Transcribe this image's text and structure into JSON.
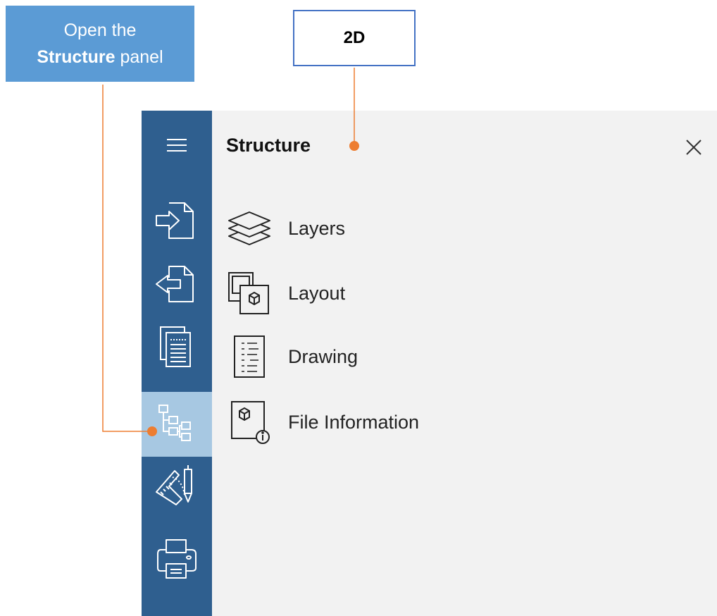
{
  "callouts": {
    "open_line1": "Open the",
    "open_bold": "Structure",
    "open_rest": "panel",
    "mode_label": "2D"
  },
  "sidebar": {
    "items": [
      {
        "icon": "hamburger-menu-icon",
        "active": false
      },
      {
        "icon": "import-icon",
        "active": false
      },
      {
        "icon": "export-icon",
        "active": false
      },
      {
        "icon": "documents-icon",
        "active": false
      },
      {
        "icon": "structure-tree-icon",
        "active": true
      },
      {
        "icon": "drafting-tools-icon",
        "active": false
      },
      {
        "icon": "printer-icon",
        "active": false
      }
    ]
  },
  "panel": {
    "title": "Structure",
    "close_icon": "close-icon",
    "items": [
      {
        "label": "Layers",
        "icon": "layers-icon"
      },
      {
        "label": "Layout",
        "icon": "layout-icon"
      },
      {
        "label": "Drawing",
        "icon": "drawing-icon"
      },
      {
        "label": "File Information",
        "icon": "file-information-icon"
      }
    ]
  },
  "colors": {
    "sidebar_bg": "#2f5f8f",
    "sidebar_active": "#a7c8e2",
    "panel_bg": "#f2f2f2",
    "callout_bg": "#5b9bd5",
    "callout_border": "#4472c4",
    "connector": "#ed7d31"
  }
}
